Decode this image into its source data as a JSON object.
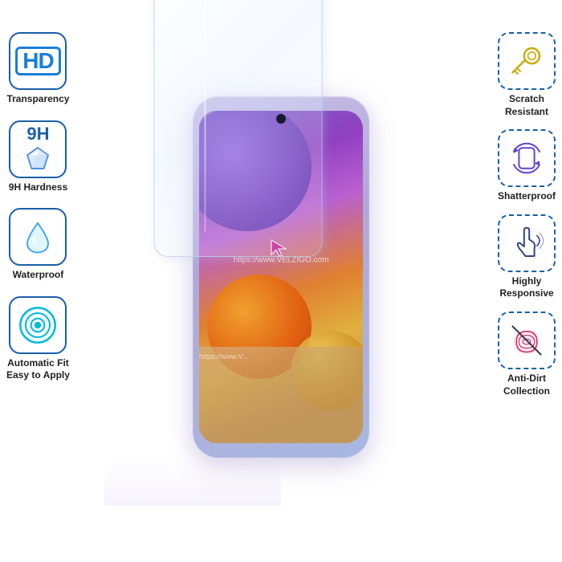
{
  "features_left": [
    {
      "id": "hd-transparency",
      "icon": "hd",
      "label": "Transparency"
    },
    {
      "id": "9h-hardness",
      "icon": "diamond",
      "label": "9H Hardness"
    },
    {
      "id": "waterproof",
      "icon": "drop",
      "label": "Waterproof"
    },
    {
      "id": "auto-fit",
      "icon": "target",
      "label": "Automatic Fit\nEasy to Apply"
    }
  ],
  "features_right": [
    {
      "id": "scratch-resistant",
      "icon": "key",
      "label": "Scratch\nResistant"
    },
    {
      "id": "shatterproof",
      "icon": "rotate",
      "label": "Shatterproof"
    },
    {
      "id": "highly-responsive",
      "icon": "touch",
      "label": "Highly\nResponsive"
    },
    {
      "id": "anti-dirt",
      "icon": "fingerprint",
      "label": "Anti-Dirt\nCollection"
    }
  ],
  "watermark": "https://www.VELZIGO.com",
  "watermark2": "https://www.V...",
  "hd_label": "HD",
  "nine_h_label": "9H"
}
